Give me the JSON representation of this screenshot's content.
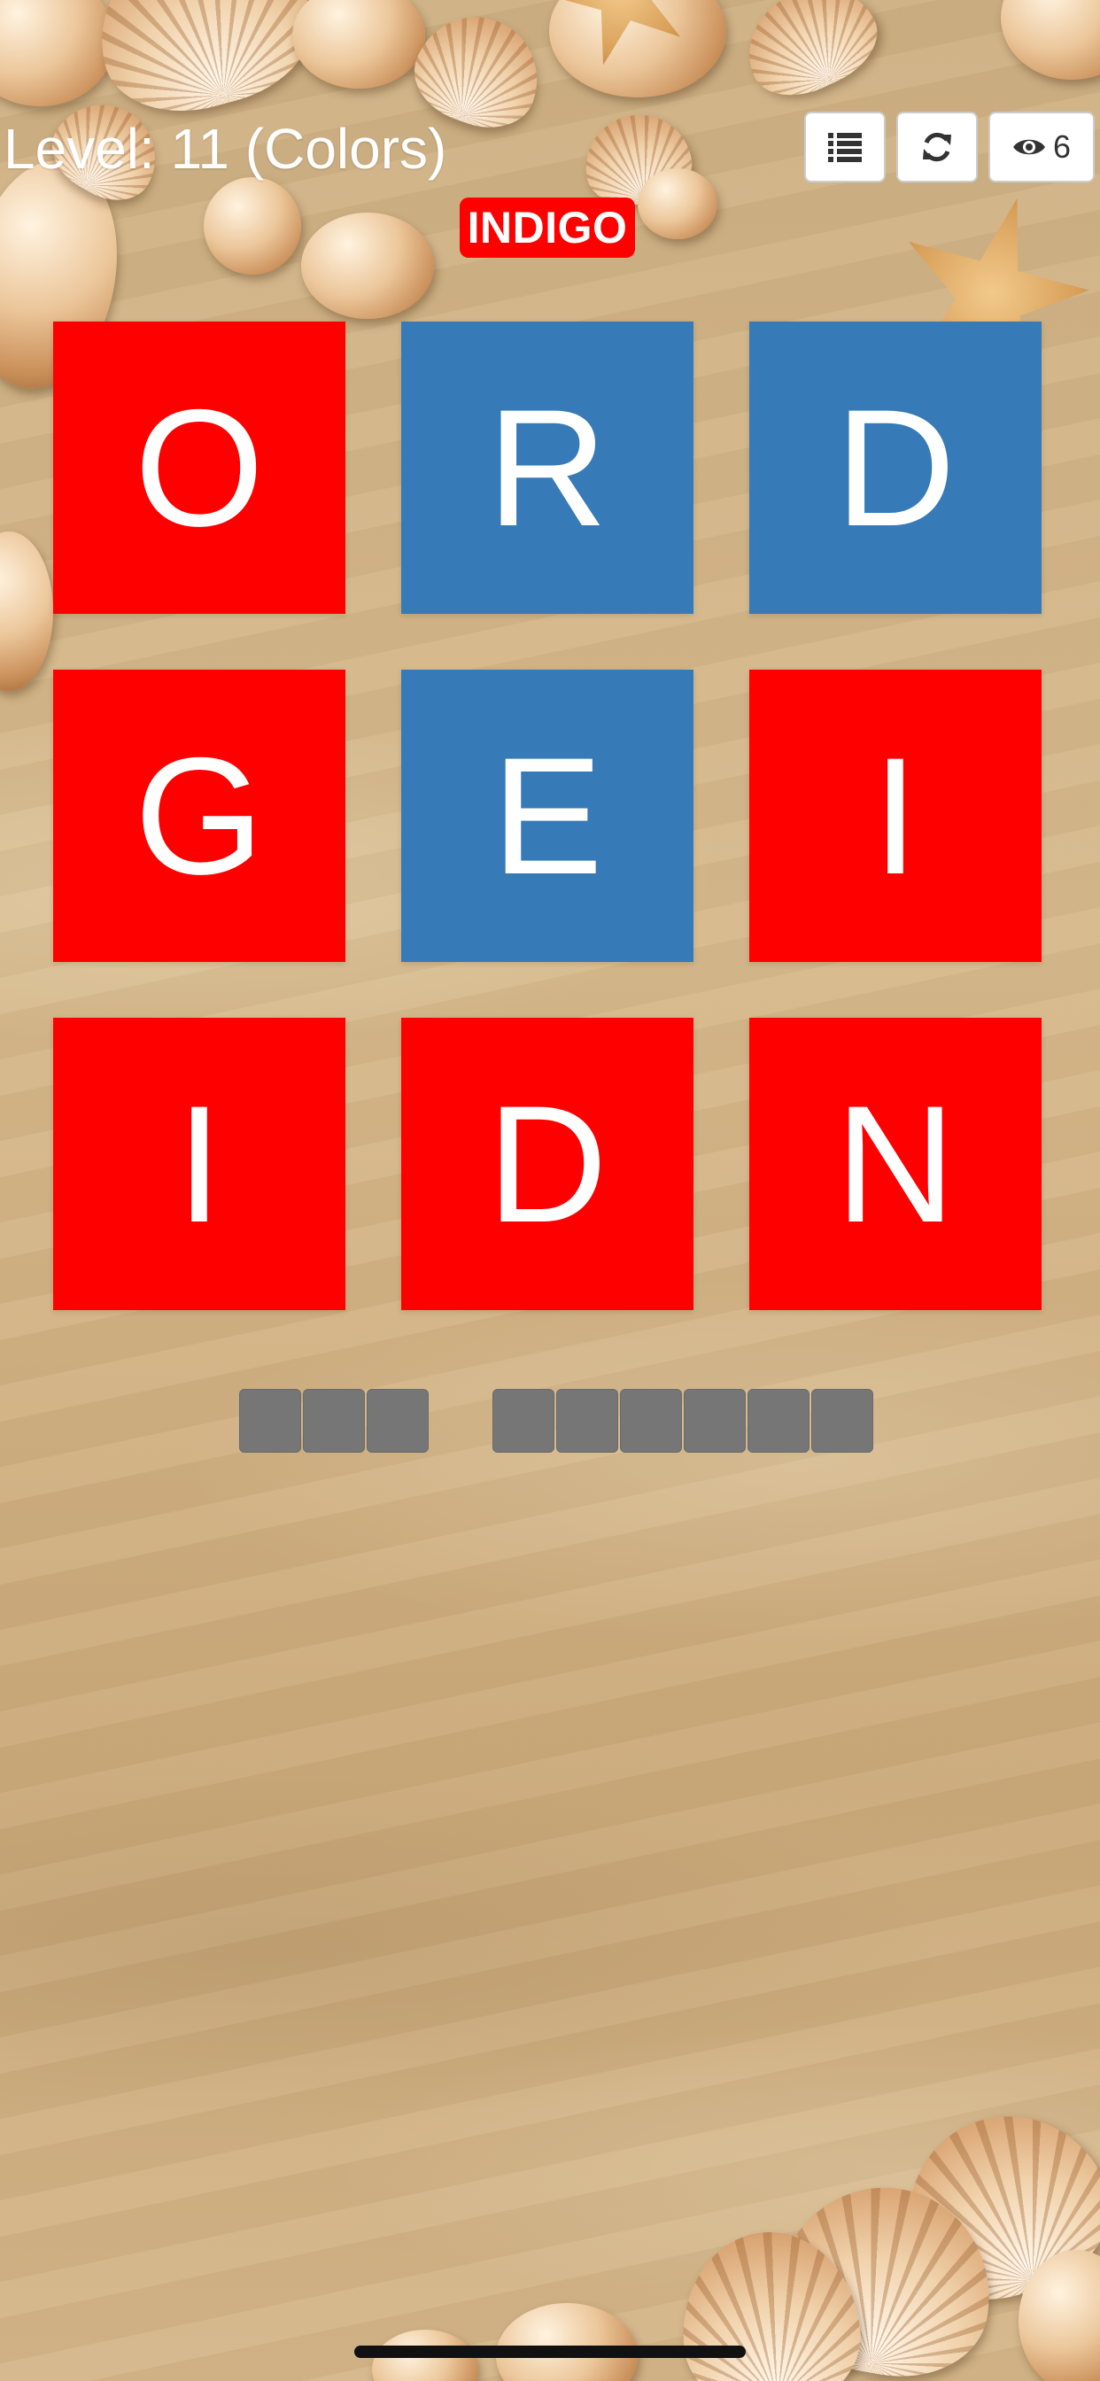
{
  "header": {
    "level_label": "Level: 11 (Colors)",
    "hint_count": "6"
  },
  "toolbar": {
    "icons": [
      "list-icon",
      "refresh-icon",
      "eye-icon"
    ]
  },
  "category": {
    "label": "INDIGO",
    "color": "#ff0000"
  },
  "colors": {
    "red": "#ff0000",
    "blue": "#367ab8",
    "slot": "#767676"
  },
  "tiles": [
    {
      "letter": "O",
      "color": "#ff0000"
    },
    {
      "letter": "R",
      "color": "#367ab8"
    },
    {
      "letter": "D",
      "color": "#367ab8"
    },
    {
      "letter": "G",
      "color": "#ff0000"
    },
    {
      "letter": "E",
      "color": "#367ab8"
    },
    {
      "letter": "I",
      "color": "#ff0000"
    },
    {
      "letter": "I",
      "color": "#ff0000"
    },
    {
      "letter": "D",
      "color": "#ff0000"
    },
    {
      "letter": "N",
      "color": "#ff0000"
    }
  ],
  "answer": {
    "word_lengths": [
      3,
      6
    ]
  }
}
